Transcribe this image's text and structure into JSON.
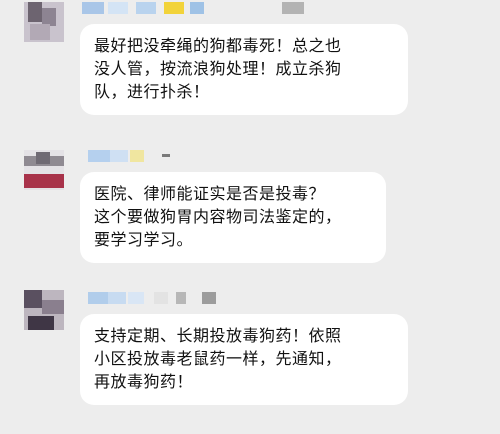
{
  "chat": {
    "messages": [
      {
        "lines": [
          "最好把没牵绳的狗都毒死！总之也",
          "没人管，按流浪狗处理！成立杀狗",
          "队，进行扑杀！"
        ]
      },
      {
        "lines": [
          "医院、律师能证实是否是投毒？",
          "这个要做狗胃内容物司法鉴定的，",
          "要学习学习。"
        ]
      },
      {
        "lines": [
          "支持定期、长期投放毒狗药！依照",
          "小区投放毒老鼠药一样，先通知，",
          "再放毒狗药！"
        ]
      }
    ]
  }
}
